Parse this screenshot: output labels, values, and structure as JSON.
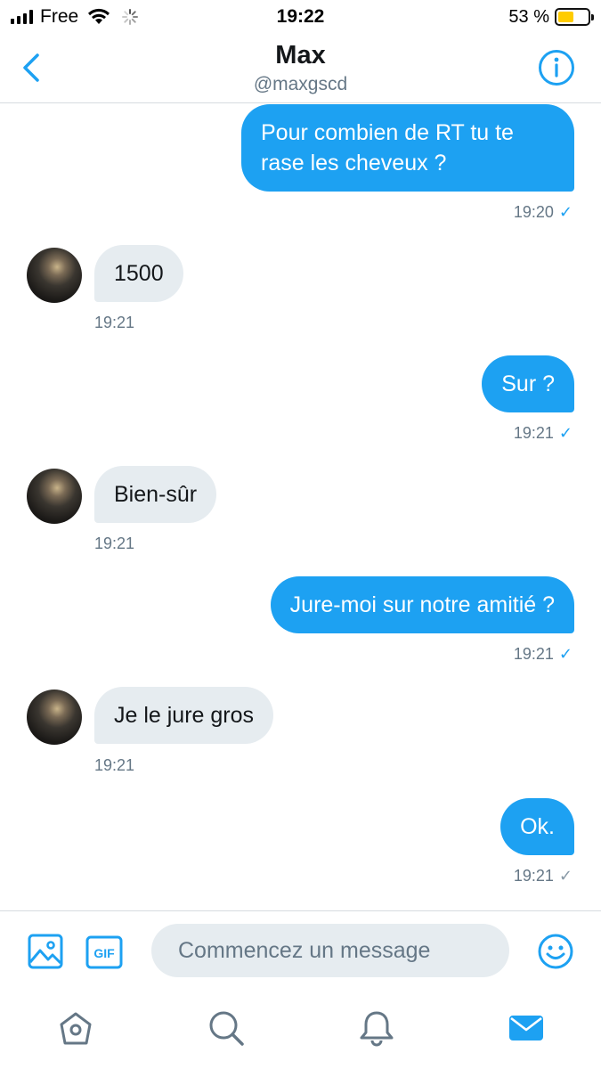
{
  "status_bar": {
    "carrier": "Free",
    "time": "19:22",
    "battery_text": "53 %",
    "battery_level": 0.53,
    "icons": [
      "signal-icon",
      "wifi-icon",
      "activity-spinner-icon",
      "battery-icon"
    ]
  },
  "header": {
    "name": "Max",
    "handle": "@maxgscd",
    "icons": [
      "back-chevron-icon",
      "info-icon"
    ]
  },
  "messages": [
    {
      "direction": "outgoing",
      "text": "Pour combien de RT tu te rase les cheveux ?",
      "time": "19:20",
      "status": "read-check"
    },
    {
      "direction": "incoming",
      "text": "1500",
      "time": "19:21"
    },
    {
      "direction": "outgoing",
      "text": "Sur ?",
      "time": "19:21",
      "status": "read-check"
    },
    {
      "direction": "incoming",
      "text": "Bien-sûr",
      "time": "19:21"
    },
    {
      "direction": "outgoing",
      "text": "Jure-moi sur notre amitié ?",
      "time": "19:21",
      "status": "read-check"
    },
    {
      "direction": "incoming",
      "text": "Je le jure gros",
      "time": "19:21"
    },
    {
      "direction": "outgoing",
      "text": "Ok.",
      "time": "19:21",
      "status": "sent-check"
    }
  ],
  "composer": {
    "placeholder": "Commencez un message",
    "gif_label": "GIF",
    "icons": [
      "image-icon",
      "gif-icon",
      "emoji-icon"
    ]
  },
  "tabbar": {
    "items": [
      "home-icon",
      "search-icon",
      "notifications-bell-icon",
      "messages-envelope-icon"
    ],
    "active": "messages-envelope-icon"
  },
  "colors": {
    "accent": "#1da1f2",
    "incoming_bubble": "#e6ecf0",
    "secondary_text": "#657786",
    "battery_fill": "#ffcc00"
  }
}
